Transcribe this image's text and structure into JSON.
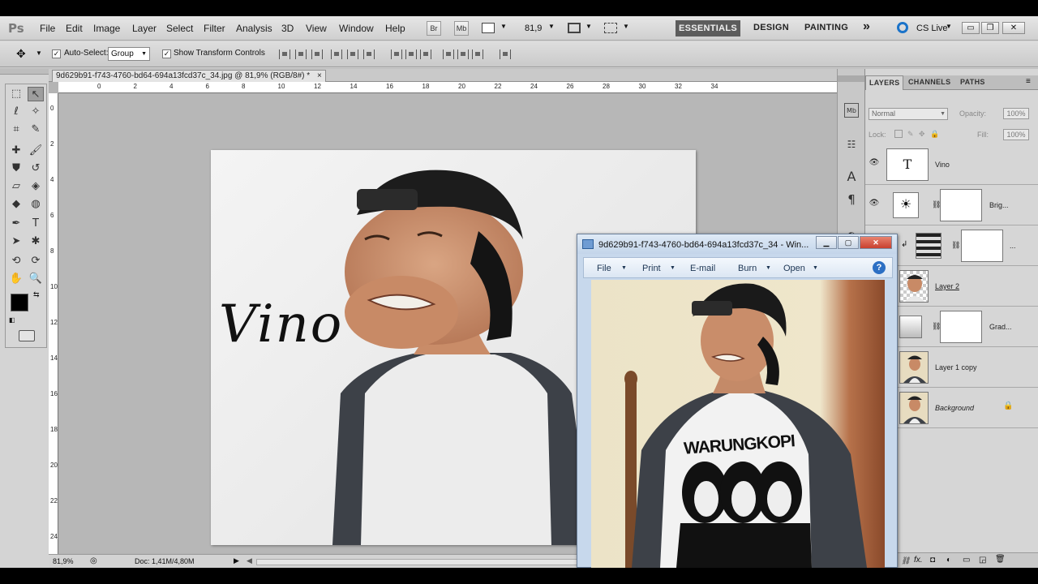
{
  "menubar": {
    "logo": "Ps",
    "items": [
      "File",
      "Edit",
      "Image",
      "Layer",
      "Select",
      "Filter",
      "Analysis",
      "3D",
      "View",
      "Window",
      "Help"
    ],
    "br_label": "Br",
    "mb_label": "Mb",
    "zoom": "81,9",
    "workspaces": [
      "ESSENTIALS",
      "DESIGN",
      "PAINTING"
    ],
    "more": "»",
    "cslive": "CS Live"
  },
  "options": {
    "auto_select_label": "Auto-Select:",
    "auto_select_value": "Group",
    "show_transform_label": "Show Transform Controls"
  },
  "document": {
    "tab_title": "9d629b91-f743-4760-bd64-694a13fcd37c_34.jpg @ 81,9% (RGB/8#) *",
    "close_x": "×",
    "ruler_h": [
      "0",
      "2",
      "4",
      "6",
      "8",
      "10",
      "12",
      "14",
      "16",
      "18",
      "20",
      "22",
      "24",
      "26",
      "28",
      "30",
      "32",
      "34"
    ],
    "ruler_v": [
      "0",
      "2",
      "4",
      "6",
      "8",
      "10",
      "12",
      "14",
      "16",
      "18",
      "20",
      "22",
      "24"
    ],
    "artwork_text": "Vino",
    "status_zoom": "81,9%",
    "status_doc": "Doc: 1,41M/4,80M"
  },
  "layers_panel": {
    "tabs": [
      "LAYERS",
      "CHANNELS",
      "PATHS"
    ],
    "blend_mode": "Normal",
    "opacity_label": "Opacity:",
    "opacity_value": "100%",
    "lock_label": "Lock:",
    "fill_label": "Fill:",
    "fill_value": "100%",
    "layers": [
      {
        "name": "Vino",
        "kind": "text"
      },
      {
        "name": "Brig...",
        "kind": "adjustment"
      },
      {
        "name": "...",
        "kind": "adjustment-clipped"
      },
      {
        "name": "Layer 2",
        "kind": "pixel"
      },
      {
        "name": "Grad...",
        "kind": "gradient"
      },
      {
        "name": "Layer 1 copy",
        "kind": "pixel"
      },
      {
        "name": "Background",
        "kind": "background"
      }
    ],
    "footer_fx": "fx."
  },
  "viewer": {
    "title": "9d629b91-f743-4760-bd64-694a13fcd37c_34 - Win...",
    "menu": [
      "File",
      "Print",
      "E-mail",
      "Burn",
      "Open"
    ],
    "shirt_text": "WARUNGKOPI",
    "help": "?"
  },
  "colors": {
    "menubar": "#d8d8d8",
    "accent_workspace": "#5c5c5c",
    "viewer_frame": "#c7d8ec",
    "close_red": "#c8402f"
  }
}
